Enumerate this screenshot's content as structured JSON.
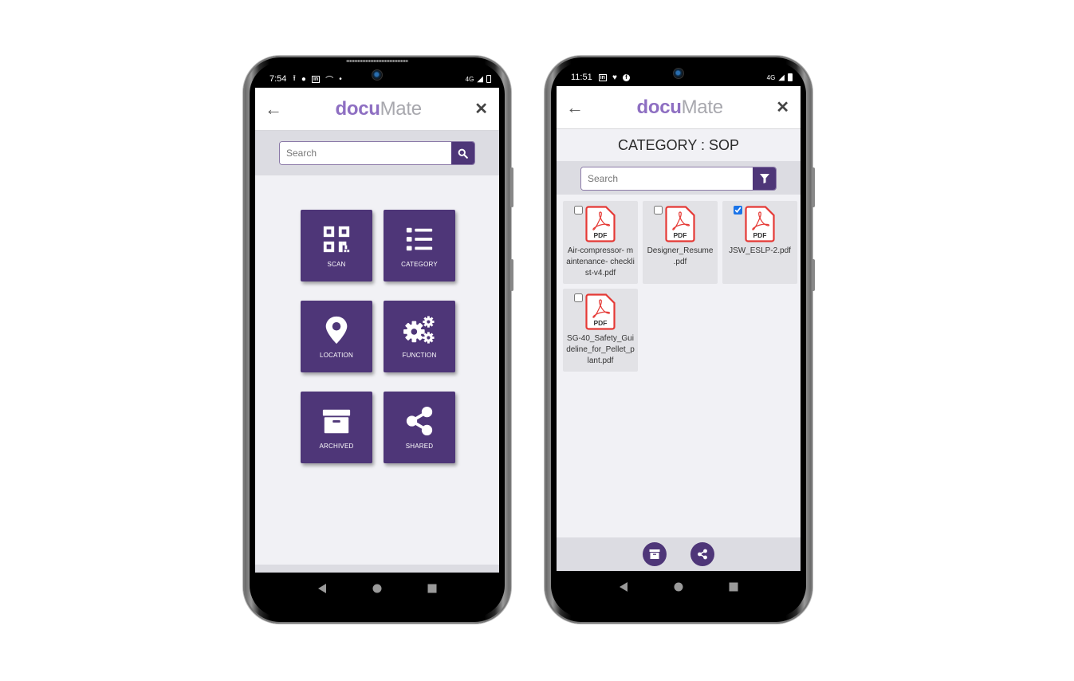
{
  "colors": {
    "brand_purple": "#4e3678",
    "logo_purple": "#8e6fc2",
    "logo_gray": "#a8a8ae",
    "pdf_red": "#e53935",
    "checkbox_blue": "#1a73e8"
  },
  "app": {
    "logo_prefix": "d",
    "logo_mid": "ocu",
    "logo_suffix": "Mate"
  },
  "phone_left": {
    "status": {
      "time": "7:54",
      "icons": [
        "upload-icon",
        "swiggy-icon",
        "linkedin-icon",
        "missed-call-icon",
        "dot-icon"
      ],
      "network": "4G"
    },
    "search": {
      "placeholder": "Search",
      "value": ""
    },
    "tiles": [
      {
        "label": "SCAN",
        "icon": "qr-code-icon"
      },
      {
        "label": "CATEGORY",
        "icon": "list-icon"
      },
      {
        "label": "LOCATION",
        "icon": "map-pin-icon"
      },
      {
        "label": "FUNCTION",
        "icon": "gears-icon"
      },
      {
        "label": "ARCHIVED",
        "icon": "archive-box-icon"
      },
      {
        "label": "SHARED",
        "icon": "share-icon"
      }
    ]
  },
  "phone_right": {
    "status": {
      "time": "11:51",
      "icons": [
        "linkedin-icon",
        "heart-pulse-icon",
        "facebook-icon"
      ],
      "network": "4G"
    },
    "title": "CATEGORY : SOP",
    "search": {
      "placeholder": "Search",
      "value": ""
    },
    "files": [
      {
        "name": "Air-compressor-maintenance-checklist-v4.pdf",
        "display": "Air-compressor- maintenance- checklist-v4.pdf",
        "type": "PDF",
        "checked": false
      },
      {
        "name": "Designer_Resume.pdf",
        "display": "Designer_Resume .pdf",
        "type": "PDF",
        "checked": false
      },
      {
        "name": "JSW_ESLP-2.pdf",
        "display": "JSW_ESLP-2.pdf",
        "type": "PDF",
        "checked": true
      },
      {
        "name": "SG-40_Safety_Guideline_for_Pellet_plant.pdf",
        "display": "SG-40_Safety_Guideline_for_Pellet_plant.pdf",
        "type": "PDF",
        "checked": false
      }
    ],
    "bottom_actions": [
      "archive-icon",
      "share-icon"
    ]
  }
}
